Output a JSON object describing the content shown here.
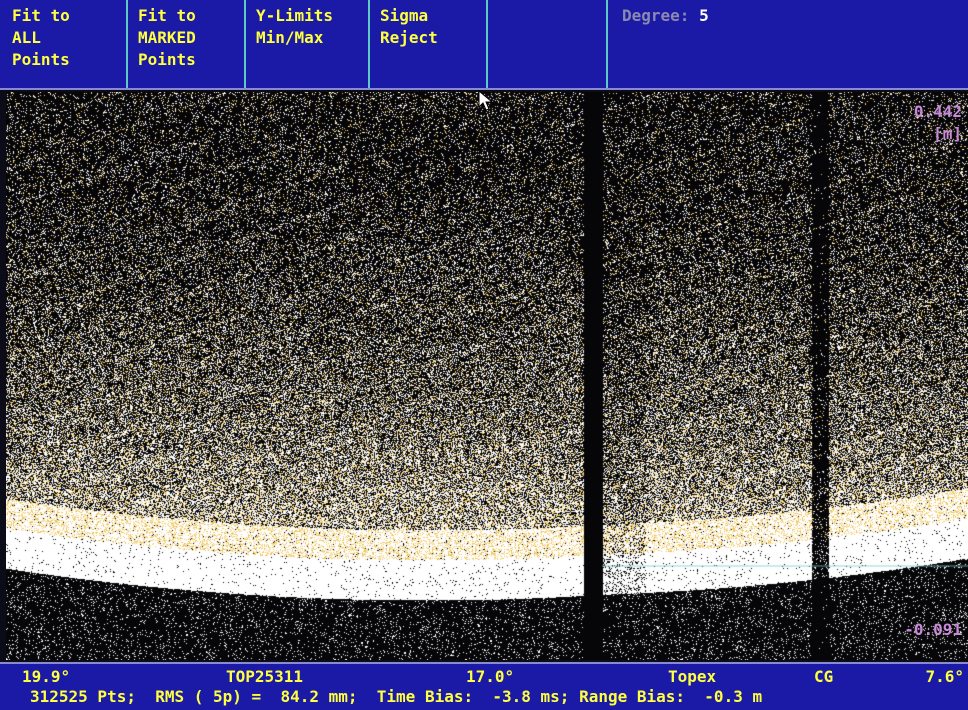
{
  "toolbar": {
    "buttons": [
      {
        "id": "fit-all",
        "label": "Fit to\nALL\nPoints"
      },
      {
        "id": "fit-marked",
        "label": "Fit to\nMARKED\nPoints"
      },
      {
        "id": "ylimits",
        "label": "Y-Limits\nMin/Max"
      },
      {
        "id": "sigma",
        "label": "Sigma\nReject"
      }
    ],
    "degree_label": "Degree:",
    "degree_value": "5"
  },
  "plot": {
    "y_max_label": "0.442",
    "y_unit_label": "[m]",
    "y_min_label": "-0.091",
    "background_color": "#060608",
    "point_colors": [
      "#ffffff",
      "#f0c860"
    ]
  },
  "status": {
    "left_angle": "19.9°",
    "pass_id": "TOP25311",
    "mid_angle": "17.0°",
    "satellite": "Topex",
    "cg_label": "CG",
    "right_angle": "7.6°",
    "summary_line": "312525 Pts;  RMS ( 5p) =  84.2 mm;  Time Bias:  -3.8 ms; Range Bias:  -0.3 m"
  },
  "colors": {
    "panel_blue": "#1a1aa6",
    "text_yellow": "#ffff40",
    "divider_cyan": "#5fc8c8",
    "axis_label_violet": "#c88ad8"
  }
}
